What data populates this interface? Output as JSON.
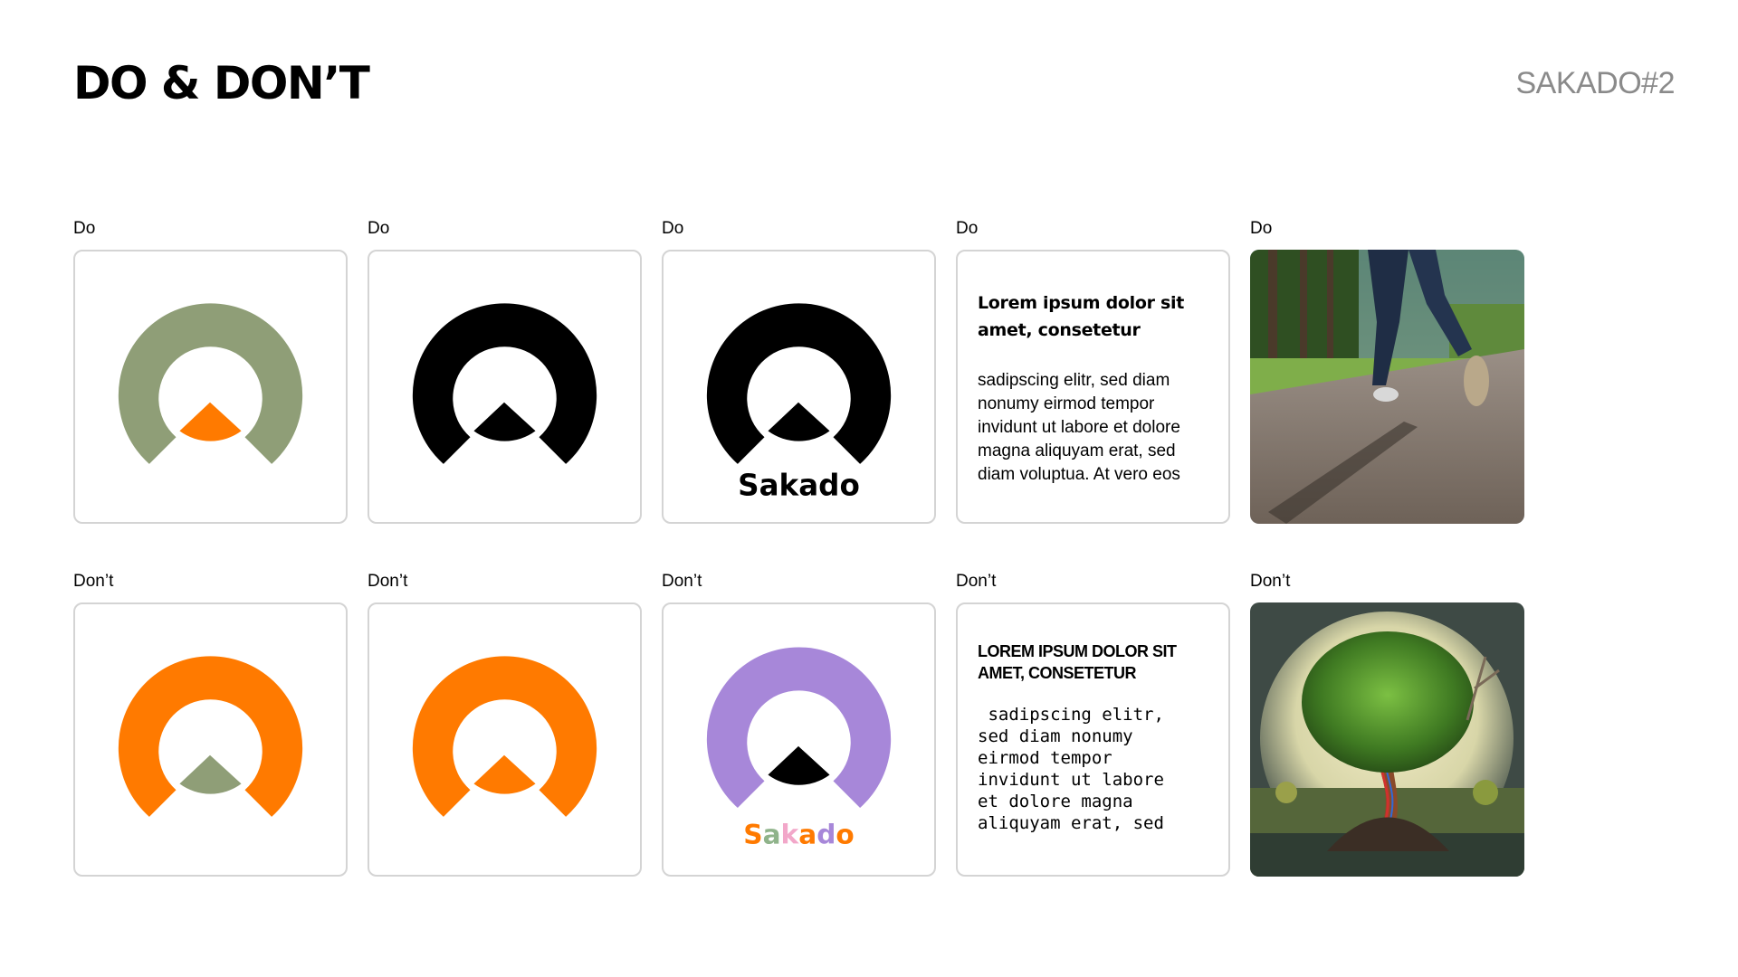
{
  "header": {
    "title": "DO & DON’T",
    "code": "SAKADO#2"
  },
  "labels": {
    "do": "Do",
    "dont": "Don’t"
  },
  "brand": {
    "wordmark": "Sakado",
    "wordmark_letters": [
      "S",
      "a",
      "k",
      "a",
      "d",
      "o"
    ]
  },
  "colors": {
    "sage": "#8f9e77",
    "orange": "#ff7a00",
    "black": "#000000",
    "purple": "#a787d9",
    "letter_colors": [
      "#ff7a00",
      "#8fb38a",
      "#f2a7c9",
      "#ff7a00",
      "#a787d9",
      "#ff7a00"
    ]
  },
  "text_card_do": {
    "heading": "Lorem ipsum dolor sit amet, consetetur",
    "body": "sadipscing elitr, sed diam nonumy eirmod tempor invidunt ut labore et dolore magna aliquyam erat, sed diam voluptua. At vero eos"
  },
  "text_card_dont": {
    "heading": "LOREM IPSUM DOLOR SIT AMET, CONSETETUR",
    "body": " sadipscing elitr,\nsed diam nonumy\neirmod tempor\ninvidunt ut labore\net dolore magna\naliquyam erat, sed"
  },
  "photos": {
    "do": "runner-on-park-path",
    "dont": "surreal-tree-on-mound"
  }
}
